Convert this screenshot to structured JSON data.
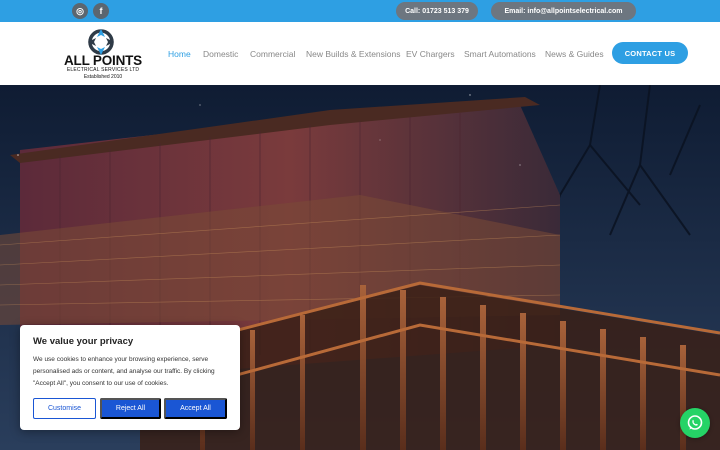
{
  "topbar": {
    "phone_label": "Call: 01723 513 379",
    "email_label": "Email: info@allpointselectrical.com",
    "social": [
      {
        "name": "instagram",
        "glyph": "◎"
      },
      {
        "name": "facebook",
        "glyph": "f"
      }
    ]
  },
  "logo": {
    "name": "ALL POINTS",
    "subtitle": "ELECTRICAL SERVICES LTD",
    "established": "Established 2010"
  },
  "nav": {
    "items": [
      {
        "label": "Home",
        "active": true
      },
      {
        "label": "Domestic",
        "active": false
      },
      {
        "label": "Commercial",
        "active": false
      },
      {
        "label": "New Builds & Extensions",
        "active": false
      },
      {
        "label": "EV Chargers",
        "active": false
      },
      {
        "label": "Smart Automations",
        "active": false
      },
      {
        "label": "News & Guides",
        "active": false
      }
    ],
    "cta_label": "CONTACT US"
  },
  "cookie_banner": {
    "title": "We value your privacy",
    "text": "We use cookies to enhance your browsing experience, serve personalised ads or content, and analyse our traffic. By clicking \"Accept All\", you consent to our use of cookies.",
    "customise_label": "Customise",
    "reject_label": "Reject All",
    "accept_label": "Accept All"
  },
  "whatsapp": {
    "icon": "whatsapp-icon"
  },
  "colors": {
    "accent": "#2e9fe3",
    "topbar_pill": "#6d7680",
    "cookie_button": "#1a56d4",
    "whatsapp": "#25d366"
  }
}
